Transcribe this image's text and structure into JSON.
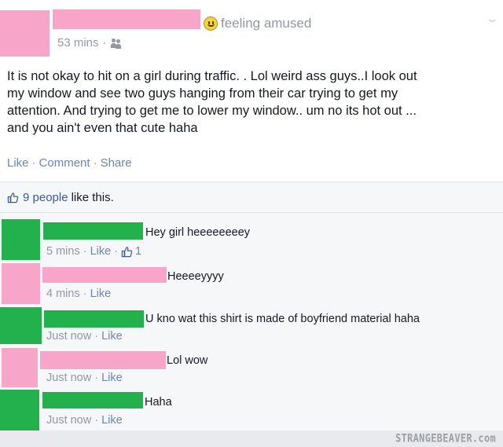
{
  "colors": {
    "redaction_pink": "#f7a6c9",
    "redaction_green": "#23b14d",
    "link_blue": "#3b5998",
    "muted_gray": "#9197a3"
  },
  "post": {
    "status": "feeling amused",
    "status_icon": "smiley-icon",
    "time": "53 mins",
    "audience_icon": "friends-icon",
    "text_lines": [
      "It is not okay to hit on a girl during traffic. . Lol weird ass guys..I look out",
      "my window and see two guys hanging from their car trying to get my",
      "attention. And trying to get me to lower my window.. um no its hot out ...",
      "and you ain't even that cute haha"
    ],
    "actions": {
      "like": "Like",
      "comment": "Comment",
      "share": "Share",
      "separator": "·"
    }
  },
  "likes": {
    "count_text": "9 people",
    "suffix": "like this."
  },
  "comments": [
    {
      "text": "Hey girl heeeeeeeey",
      "time": "5 mins",
      "like": "Like",
      "like_count": "1"
    },
    {
      "text": "Heeeeyyyy",
      "time": "4 mins",
      "like": "Like"
    },
    {
      "text": "U kno wat this shirt is made of boyfriend material haha",
      "time": "Just now",
      "like": "Like"
    },
    {
      "text": "Lol wow",
      "time": "Just now",
      "like": "Like"
    },
    {
      "text": "Haha",
      "time": "Just now",
      "like": "Like"
    }
  ],
  "watermark": "STRANGEBEAVER.com"
}
